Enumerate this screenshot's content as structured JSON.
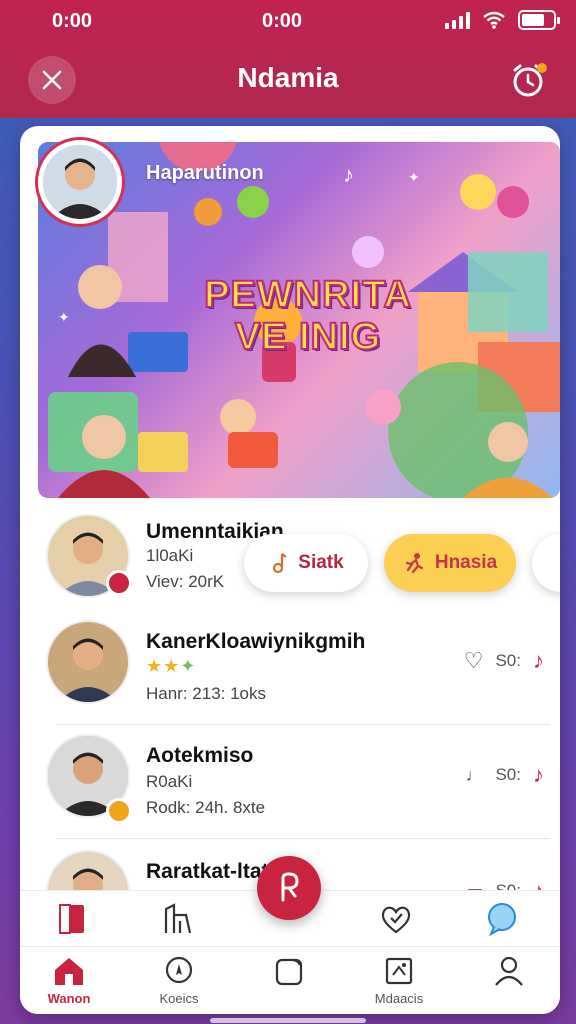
{
  "status_bar": {
    "left_time": "0:00",
    "center_time": "0:00"
  },
  "header": {
    "title": "Ndamia"
  },
  "banner": {
    "caption": "Haparutinon",
    "headline_line1": "PEWNRITA",
    "headline_line2": "VE INIG"
  },
  "list": [
    {
      "title": "Umenntaikian",
      "meta1": "1l0aKi",
      "meta2": "Viev: 20rK",
      "badge_color": "#c8243f"
    },
    {
      "title": "KanerKloawiynikgmih",
      "rating_stars": 3,
      "meta2": "Hanr: 213:  1oks",
      "action_like": "♡",
      "action_count": "S0:",
      "action_music": "♪"
    },
    {
      "title": "Aotekmiso",
      "meta1": "R0aKi",
      "meta2": "Rodk: 24h.  8xte",
      "action_count": "S0:",
      "action_music": "♪",
      "badge_color": "#f2a41a"
    },
    {
      "title": "Raratkat-ltat",
      "action_count": "S0:",
      "action_music": "♪"
    }
  ],
  "pills": {
    "start_label": "Siatk",
    "hnasia_label": "Hnasia"
  },
  "nav": {
    "items": [
      {
        "label": "Wanon"
      },
      {
        "label": "Koeics"
      },
      {
        "label": ""
      },
      {
        "label": "Mdaacis"
      },
      {
        "label": ""
      }
    ]
  },
  "colors": {
    "brand": "#c8243f",
    "accent_yellow": "#fbd052",
    "star": "#f2b318"
  }
}
